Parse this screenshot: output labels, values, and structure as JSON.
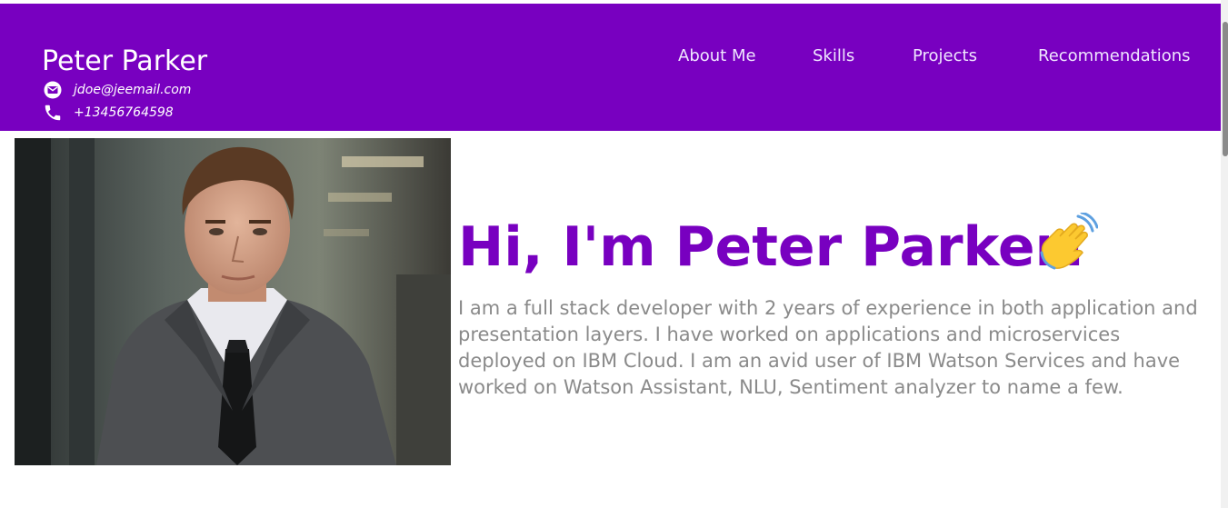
{
  "header": {
    "name": "Peter Parker",
    "email": "jdoe@jeemail.com",
    "phone": "+13456764598",
    "email_icon": "email-icon",
    "phone_icon": "phone-icon",
    "nav": [
      {
        "label": "About Me"
      },
      {
        "label": "Skills"
      },
      {
        "label": "Projects"
      },
      {
        "label": "Recommendations"
      }
    ]
  },
  "hero": {
    "greeting": "Hi, I'm Peter Parker!",
    "wave_icon": "waving-hand-icon",
    "bio": "I am a full stack developer with 2 years of experience in both application and presentation layers. I have worked on applications and microservices deployed on IBM Cloud. I am an avid user of IBM Watson Services and have worked on Watson Assistant, NLU, Sentiment analyzer to name a few."
  },
  "colors": {
    "brand": "#7800c0",
    "header_text": "#ffffff",
    "bio_text": "#8a8a8a"
  }
}
